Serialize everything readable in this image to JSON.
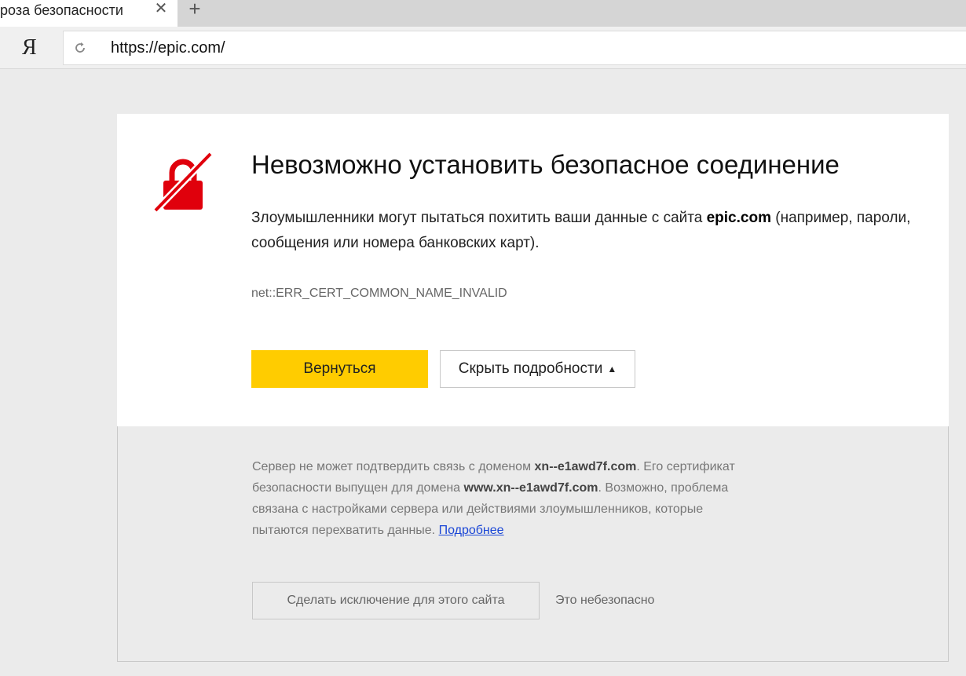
{
  "browser": {
    "tab_title": "роза безопасности",
    "close_glyph": "✕",
    "new_tab_glyph": "+",
    "logo_text": "Я",
    "url": "https://epic.com/"
  },
  "page": {
    "headline": "Невозможно установить безопасное соединение",
    "desc_part1": "Злоумышленники могут пытаться похитить ваши данные с сайта ",
    "desc_domain": "epic.com",
    "desc_part2": " (например, пароли, сообщения или номера банковских карт).",
    "error_code": "net::ERR_CERT_COMMON_NAME_INVALID",
    "back_button": "Вернуться",
    "hide_details_button": "Скрыть подробности",
    "hide_arrow": "▲"
  },
  "details": {
    "part1": "Сервер не может подтвердить связь с доменом ",
    "domain1": "xn--e1awd7f.com",
    "part2": ". Его сертификат безопасности выпущен для домена ",
    "domain2": "www.xn--e1awd7f.com",
    "part3": ". Возможно, проблема связана с настройками сервера или действиями злоумышленников, которые пытаются перехватить данные. ",
    "more_link": "Подробнее",
    "exception_button": "Сделать исключение для этого сайта",
    "unsafe_note": "Это небезопасно"
  },
  "colors": {
    "primary_button": "#ffcc00",
    "danger_icon": "#e0000c",
    "link": "#1a46d6"
  }
}
